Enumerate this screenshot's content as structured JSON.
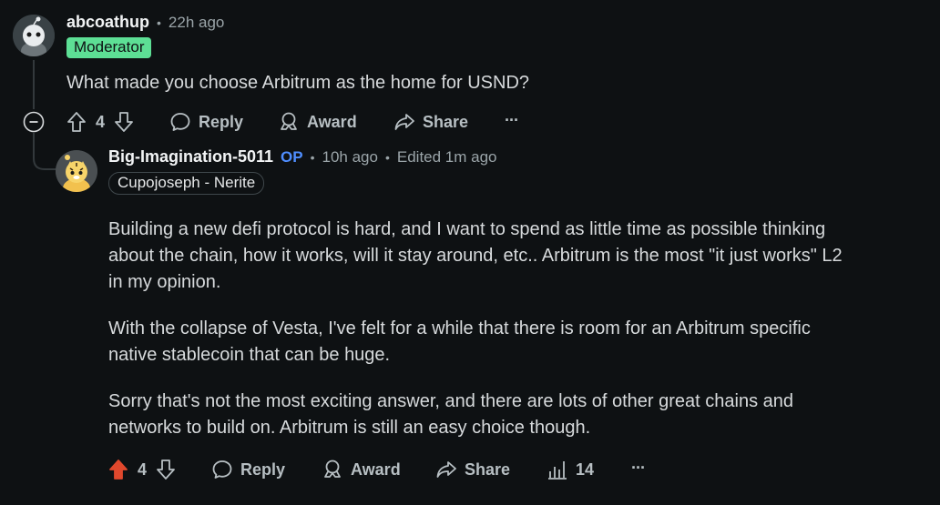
{
  "comment1": {
    "username": "abcoathup",
    "separator": "•",
    "time": "22h ago",
    "badge": "Moderator",
    "text": "What made you choose Arbitrum as the home for USND?",
    "votes": "4",
    "reply_label": "Reply",
    "award_label": "Award",
    "share_label": "Share",
    "more_label": "···",
    "collapse_glyph": "−"
  },
  "comment2": {
    "username": "Big-Imagination-5011",
    "op_label": "OP",
    "separator": "•",
    "time": "10h ago",
    "edited": "Edited 1m ago",
    "flair": "Cupojoseph - Nerite",
    "paragraphs": [
      "Building a new defi protocol is hard, and I want to spend as little time as possible thinking",
      "about the chain, how it works, will it stay around, etc.. Arbitrum is the most \"it just works\" L2",
      "in my opinion.",
      "With the collapse of Vesta, I've felt for a while that there is room for an Arbitrum specific",
      "native stablecoin that can be huge.",
      "Sorry that's not the most exciting answer, and there are lots of other great chains and",
      "networks to build on. Arbitrum is still an easy choice though."
    ],
    "votes": "4",
    "reply_label": "Reply",
    "award_label": "Award",
    "share_label": "Share",
    "insights_count": "14",
    "more_label": "···"
  },
  "colors": {
    "background": "#0e1113",
    "moderator_badge": "#5ddf95",
    "op_label": "#4f8eff",
    "upvote_active": "#e0482d"
  },
  "icons": [
    "collapse-icon",
    "upvote-icon",
    "downvote-icon",
    "reply-icon",
    "award-icon",
    "share-icon",
    "insights-icon",
    "more-icon"
  ]
}
